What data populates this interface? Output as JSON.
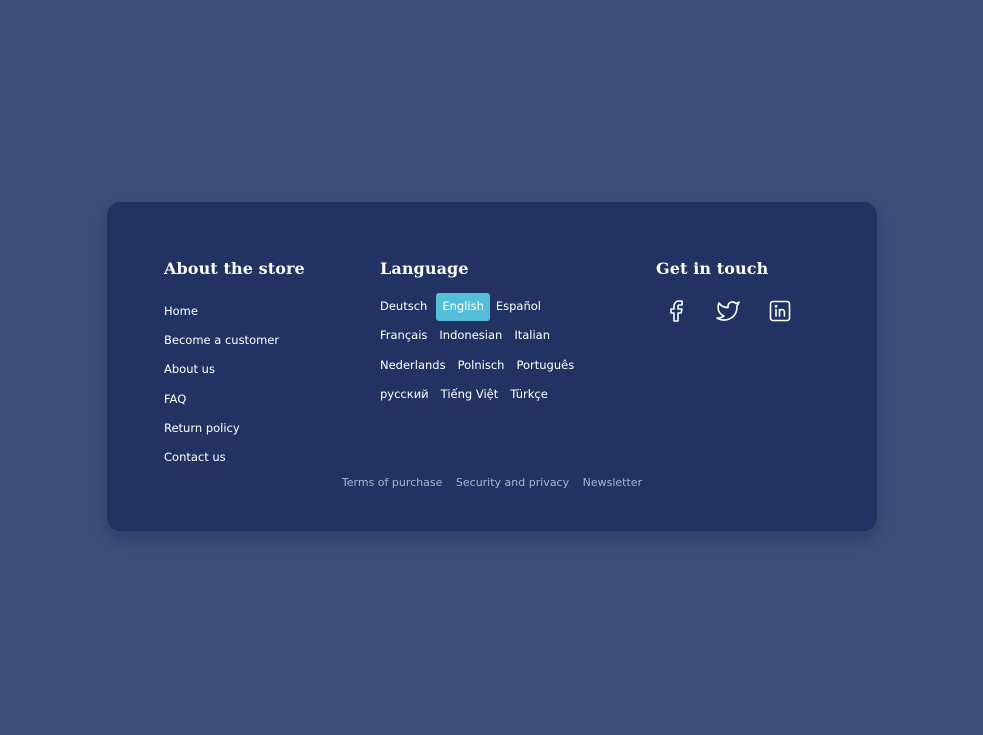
{
  "about": {
    "heading": "About the store",
    "links": [
      "Home",
      "Become a customer",
      "About us",
      "FAQ",
      "Return policy",
      "Contact us"
    ]
  },
  "language": {
    "heading": "Language",
    "selected": "English",
    "rows": [
      [
        "Deutsch",
        "English",
        "Español"
      ],
      [
        "Français",
        "Indonesian",
        "Italian"
      ],
      [
        "Nederlands",
        "Polnisch",
        "Português"
      ],
      [
        "русский",
        "Tiếng Việt",
        "Türkçe"
      ]
    ]
  },
  "contact": {
    "heading": "Get in touch",
    "social": [
      "facebook-icon",
      "twitter-icon",
      "linkedin-icon"
    ]
  },
  "bottom_links": [
    "Terms of purchase",
    "Security and privacy",
    "Newsletter"
  ],
  "colors": {
    "background": "#3d5079",
    "card": "#223363",
    "accent": "#55bfd9",
    "muted_link": "#aab5cd"
  }
}
